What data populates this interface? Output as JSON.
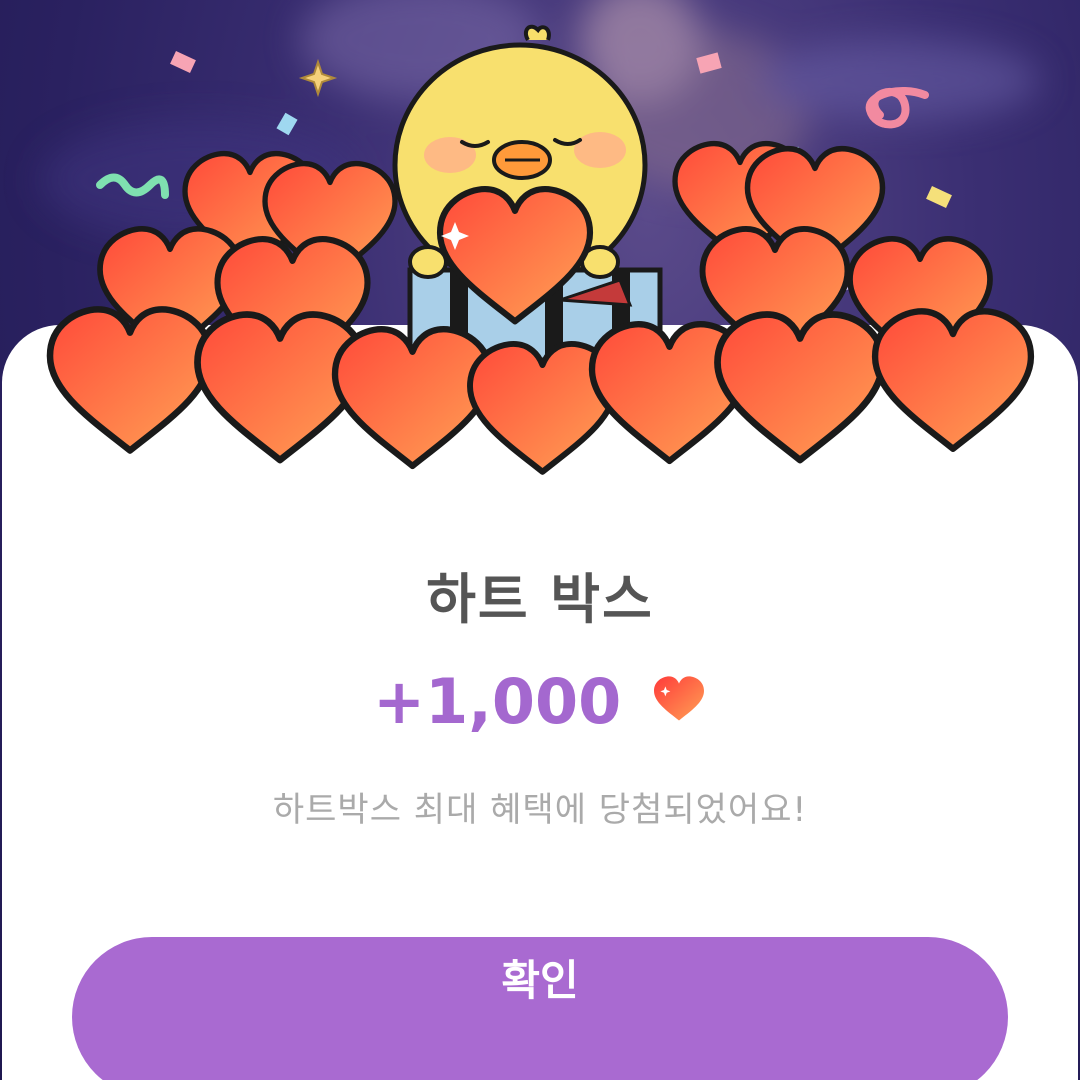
{
  "dialog": {
    "title": "하트 박스",
    "reward_amount": "+1,000",
    "reward_icon": "heart-icon",
    "message": "하트박스 최대 혜택에 당첨되었어요!",
    "confirm_label": "확인"
  },
  "colors": {
    "accent": "#a96ad1",
    "reward_text": "#a468cf",
    "title_text": "#555555",
    "message_text": "#aaaaaa",
    "heart": "#ff6a3d",
    "backdrop": "#2f2568"
  }
}
